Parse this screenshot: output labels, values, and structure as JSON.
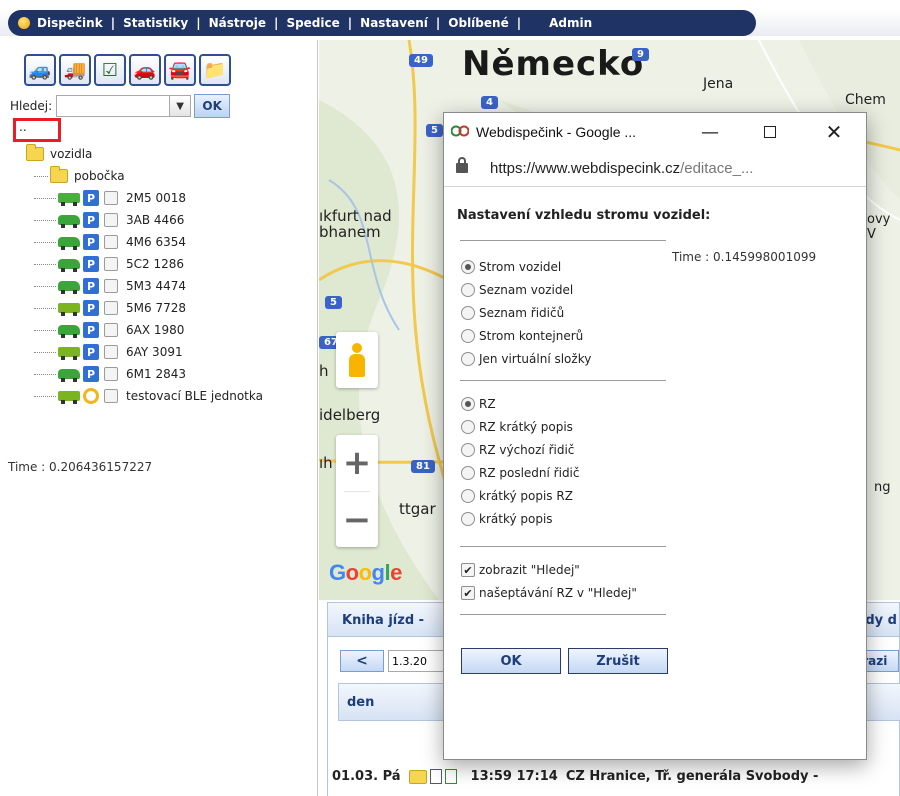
{
  "menu": {
    "items": [
      "Dispečink",
      "Statistiky",
      "Nástroje",
      "Spedice",
      "Nastavení",
      "Oblíbené",
      "Admin"
    ],
    "separator": "|"
  },
  "left": {
    "search_label": "Hledej:",
    "search_value": "",
    "ok_label": "OK",
    "up_link": "..",
    "tree": {
      "root": "vozidla",
      "branch": "pobočka",
      "vehicles": [
        {
          "plate": "2M5 0018",
          "type": "bus",
          "badge": "P"
        },
        {
          "plate": "3AB 4466",
          "type": "car",
          "badge": "P"
        },
        {
          "plate": "4M6 6354",
          "type": "car",
          "badge": "P"
        },
        {
          "plate": "5C2 1286",
          "type": "car",
          "badge": "P"
        },
        {
          "plate": "5M3 4474",
          "type": "car",
          "badge": "P"
        },
        {
          "plate": "5M6 7728",
          "type": "truck",
          "badge": "P"
        },
        {
          "plate": "6AX 1980",
          "type": "car",
          "badge": "P"
        },
        {
          "plate": "6AY 3091",
          "type": "truck",
          "badge": "P"
        },
        {
          "plate": "6M1 2843",
          "type": "car",
          "badge": "P"
        },
        {
          "plate": "testovací BLE jednotka",
          "type": "truck",
          "badge": "ble"
        }
      ]
    },
    "time": "Time : 0.206436157227"
  },
  "map": {
    "country": "Německo",
    "labels": {
      "jena": "Jena",
      "chem": "Chem",
      "frankfurt_1": "ıkfurt nad",
      "frankfurt_2": "bhanem",
      "heidelberg": "idelberg",
      "stuttgart": "ttgar",
      "ovy": "ovy V",
      "ng": "ng",
      "h": "h",
      "uh": "ıh"
    },
    "shields": [
      "49",
      "9",
      "4",
      "5",
      "5",
      "67",
      "81"
    ],
    "zoom_in": "+",
    "zoom_out": "−",
    "google": [
      "G",
      "o",
      "o",
      "g",
      "l",
      "e"
    ]
  },
  "kniha": {
    "title": "Kniha jízd -",
    "title_right": "dy d",
    "prev_label": "<",
    "date_value": "1.3.20",
    "zobr_label": "orazi",
    "col_den": "den",
    "row": {
      "date": "01.03. Pá",
      "times": "13:59  17:14",
      "address": "CZ Hranice, Tř. generála Svobody -"
    }
  },
  "popup": {
    "title": "Webdispečink - Google ...",
    "url_host": "https://www.webdispecink.cz",
    "url_path": "/editace_...",
    "settings_title": "Nastavení vzhledu stromu vozidel:",
    "time": "Time : 0.145998001099",
    "group1": [
      {
        "label": "Strom vozidel",
        "checked": true
      },
      {
        "label": "Seznam vozidel",
        "checked": false
      },
      {
        "label": "Seznam řidičů",
        "checked": false
      },
      {
        "label": "Strom kontejnerů",
        "checked": false
      },
      {
        "label": "Jen virtuální složky",
        "checked": false
      }
    ],
    "group2": [
      {
        "label": "RZ",
        "checked": true
      },
      {
        "label": "RZ krátký popis",
        "checked": false
      },
      {
        "label": "RZ výchozí řidič",
        "checked": false
      },
      {
        "label": "RZ poslední řidič",
        "checked": false
      },
      {
        "label": "krátký popis RZ",
        "checked": false
      },
      {
        "label": "krátký popis",
        "checked": false
      }
    ],
    "checkboxes": [
      {
        "label": "zobrazit \"Hledej\"",
        "checked": true
      },
      {
        "label": "našeptávání RZ v \"Hledej\"",
        "checked": true
      }
    ],
    "ok_label": "OK",
    "cancel_label": "Zrušit"
  },
  "colors": {
    "menu_bg": "#1f3464",
    "accent_blue": "#1d3e7a",
    "highlight_red": "#ea1c24",
    "folder_yellow": "#f7d64f",
    "badge_blue": "#2f6fd6"
  }
}
